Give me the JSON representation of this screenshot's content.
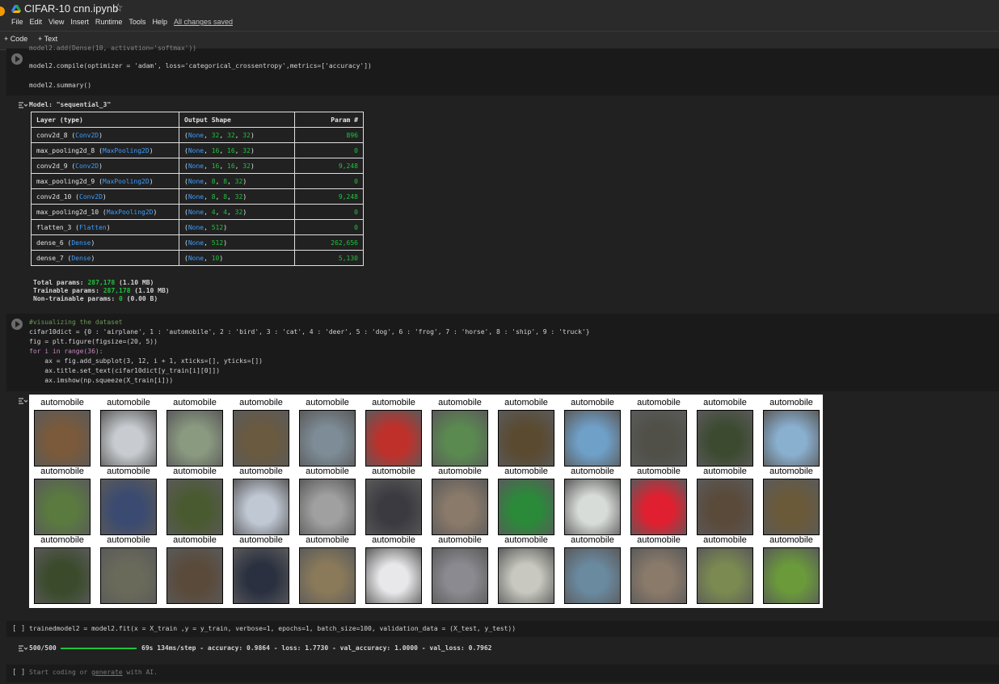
{
  "header": {
    "title": "CIFAR-10 cnn.ipynb",
    "star_icon": "star-icon",
    "menu": [
      "File",
      "Edit",
      "View",
      "Insert",
      "Runtime",
      "Tools",
      "Help"
    ],
    "saved_status": "All changes saved"
  },
  "toolbar": {
    "code_label": "+ Code",
    "text_label": "+ Text"
  },
  "cell1": {
    "lines": [
      "model2.compile(optimizer = 'adam', loss='categorical_crossentropy',metrics=['accuracy'])",
      "model2.summary()"
    ]
  },
  "summary": {
    "model_title": "Model: \"sequential_3\"",
    "headers": [
      "Layer (type)",
      "Output Shape",
      "Param #"
    ],
    "rows": [
      {
        "name": "conv2d_8",
        "type": "Conv2D",
        "shape": [
          "None",
          "32",
          "32",
          "32"
        ],
        "params": "896"
      },
      {
        "name": "max_pooling2d_8",
        "type": "MaxPooling2D",
        "shape": [
          "None",
          "16",
          "16",
          "32"
        ],
        "params": "0"
      },
      {
        "name": "conv2d_9",
        "type": "Conv2D",
        "shape": [
          "None",
          "16",
          "16",
          "32"
        ],
        "params": "9,248"
      },
      {
        "name": "max_pooling2d_9",
        "type": "MaxPooling2D",
        "shape": [
          "None",
          "8",
          "8",
          "32"
        ],
        "params": "0"
      },
      {
        "name": "conv2d_10",
        "type": "Conv2D",
        "shape": [
          "None",
          "8",
          "8",
          "32"
        ],
        "params": "9,248"
      },
      {
        "name": "max_pooling2d_10",
        "type": "MaxPooling2D",
        "shape": [
          "None",
          "4",
          "4",
          "32"
        ],
        "params": "0"
      },
      {
        "name": "flatten_3",
        "type": "Flatten",
        "shape": [
          "None",
          "512"
        ],
        "params": "0"
      },
      {
        "name": "dense_6",
        "type": "Dense",
        "shape": [
          "None",
          "512"
        ],
        "params": "262,656"
      },
      {
        "name": "dense_7",
        "type": "Dense",
        "shape": [
          "None",
          "10"
        ],
        "params": "5,130"
      }
    ],
    "total_label": "Total params:",
    "total_value": "287,178",
    "total_size": "(1.10 MB)",
    "trainable_label": "Trainable params:",
    "trainable_value": "287,178",
    "trainable_size": "(1.10 MB)",
    "nontrainable_label": "Non-trainable params:",
    "nontrainable_value": "0",
    "nontrainable_size": "(0.00 B)"
  },
  "cell2": {
    "comment": "#visualizing the dataset",
    "dict_line": "cifar10dict = {0 : 'airplane', 1 : 'automobile', 2 : 'bird', 3 : 'cat', 4 : 'deer', 5 : 'dog', 6 : 'frog', 7 : 'horse', 8 : 'ship', 9 : 'truck'}",
    "fig_line": "fig = plt.figure(figsize=(20, 5))",
    "for_line": "for i in range(36):",
    "ax_line": "    ax = fig.add_subplot(3, 12, i + 1, xticks=[], yticks=[])",
    "title_line": "    ax.title.set_text(cifar10dict[y_train[i][0]])",
    "imshow_line": "    ax.imshow(np.squeeze(X_train[i]))"
  },
  "figure": {
    "subplot_title": "automobile",
    "thumb_colors": [
      [
        "#7a5a3a",
        "#c8ccd0",
        "#8a9a80",
        "#6a5a40",
        "#7d8c96",
        "#c0302a",
        "#5a8a50",
        "#5a4a30",
        "#6fa0c8",
        "#505048",
        "#3c4a30",
        "#8ab0d0"
      ],
      [
        "#5a7a40",
        "#3a4a70",
        "#4a5a30",
        "#c0c8d4",
        "#a0a0a0",
        "#3a3a40",
        "#8a7a6a",
        "#2a8a3a",
        "#d8dcd8",
        "#e02030",
        "#5a4a3a",
        "#6a5a3a"
      ],
      [
        "#3a4a2a",
        "#6a6a5a",
        "#5a4a3a",
        "#2a3040",
        "#8a7a5a",
        "#e8e8ea",
        "#8a8a90",
        "#c8c8c0",
        "#6a8aa0",
        "#8a7a6a",
        "#7a8a50",
        "#6a9a3a"
      ]
    ]
  },
  "cell3": {
    "bracket": "[ ]",
    "code": "trainedmodel2 = model2.fit(x = X_train ,y = y_train, verbose=1, epochs=1, batch_size=100, validation_data = (X_test, y_test))",
    "progress_count": "500/500",
    "progress_fraction": 1.0,
    "progress_stats": "69s 134ms/step - accuracy: 0.9864 - loss: 1.7730 - val_accuracy: 1.0000 - val_loss: 0.7962"
  },
  "cell4": {
    "bracket": "[ ]",
    "placeholder_start": "Start coding or ",
    "placeholder_link": "generate",
    "placeholder_end": " with AI."
  }
}
